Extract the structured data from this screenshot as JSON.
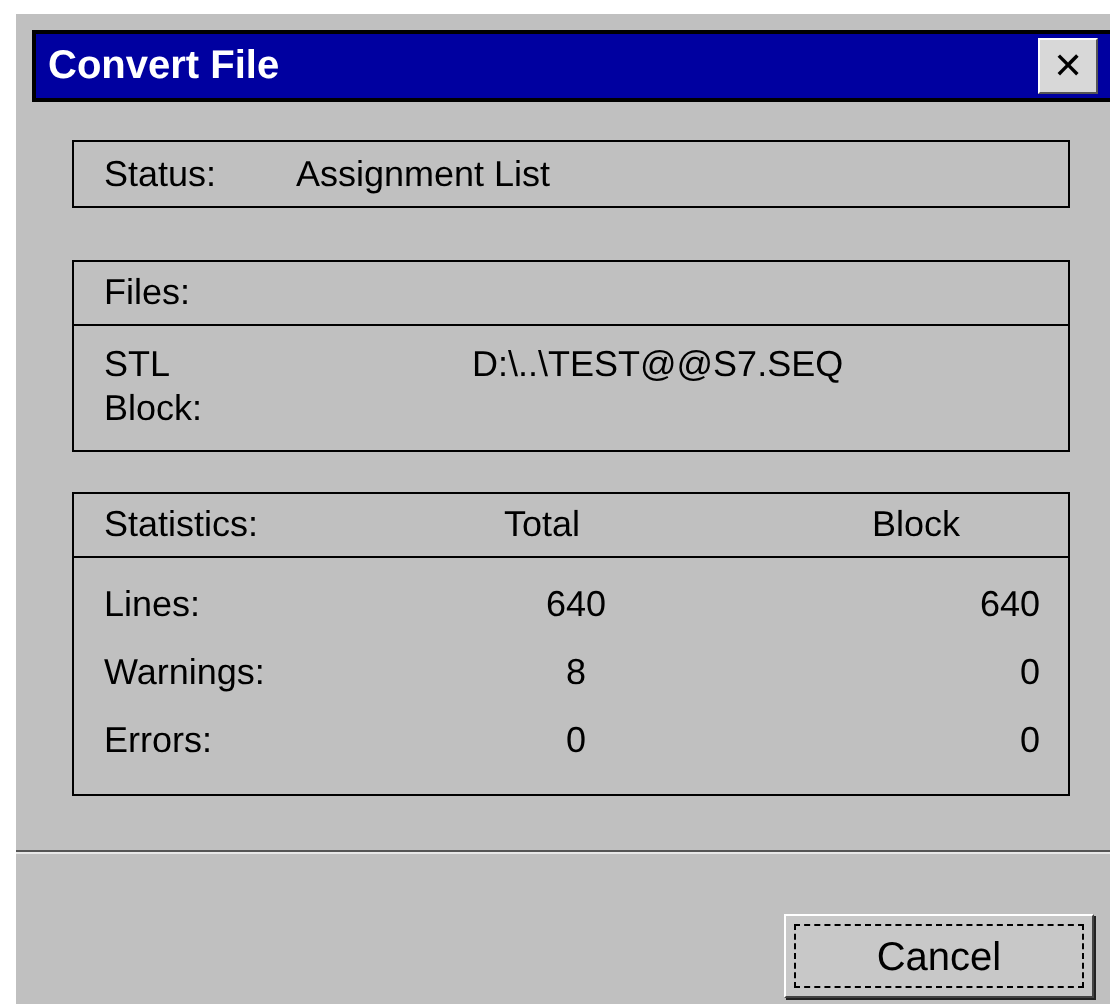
{
  "window": {
    "title": "Convert File",
    "close_button": "✕"
  },
  "status": {
    "label": "Status:",
    "value": "Assignment List"
  },
  "files": {
    "heading": "Files:",
    "rows": [
      {
        "label": "STL\nBlock:",
        "value": "D:\\..\\TEST@@S7.SEQ"
      }
    ]
  },
  "statistics": {
    "columns": [
      "Statistics:",
      "Total",
      "Block"
    ],
    "rows": [
      {
        "label": "Lines:",
        "total": "640",
        "block": "640"
      },
      {
        "label": "Warnings:",
        "total": "8",
        "block": "0"
      },
      {
        "label": "Errors:",
        "total": "0",
        "block": "0"
      }
    ]
  },
  "buttons": [
    {
      "label": "Cancel",
      "focused": true
    }
  ]
}
